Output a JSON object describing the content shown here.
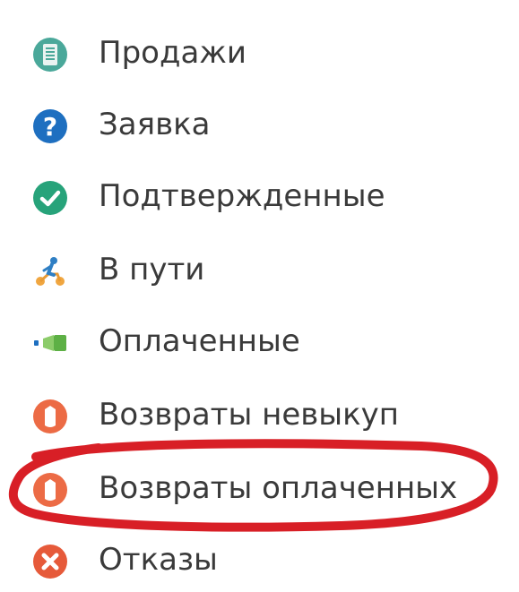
{
  "menu": {
    "items": [
      {
        "label": "Продажи",
        "icon": "sales-document-icon",
        "color": "#4aa89a"
      },
      {
        "label": "Заявка",
        "icon": "question-icon",
        "color": "#1e6fc0"
      },
      {
        "label": "Подтвержденные",
        "icon": "check-icon",
        "color": "#27a37a"
      },
      {
        "label": "В пути",
        "icon": "courier-icon",
        "color": "#2f7fc4"
      },
      {
        "label": "Оплаченные",
        "icon": "paid-flag-icon",
        "color": "#6bbf4a"
      },
      {
        "label": "Возвраты невыкуп",
        "icon": "return-unredeemed-icon",
        "color": "#ec6b45"
      },
      {
        "label": "Возвраты оплаченных",
        "icon": "return-paid-icon",
        "color": "#ec6b45"
      },
      {
        "label": "Отказы",
        "icon": "cancel-icon",
        "color": "#e65a3a"
      }
    ]
  },
  "annotation": {
    "color": "#d81f26"
  }
}
